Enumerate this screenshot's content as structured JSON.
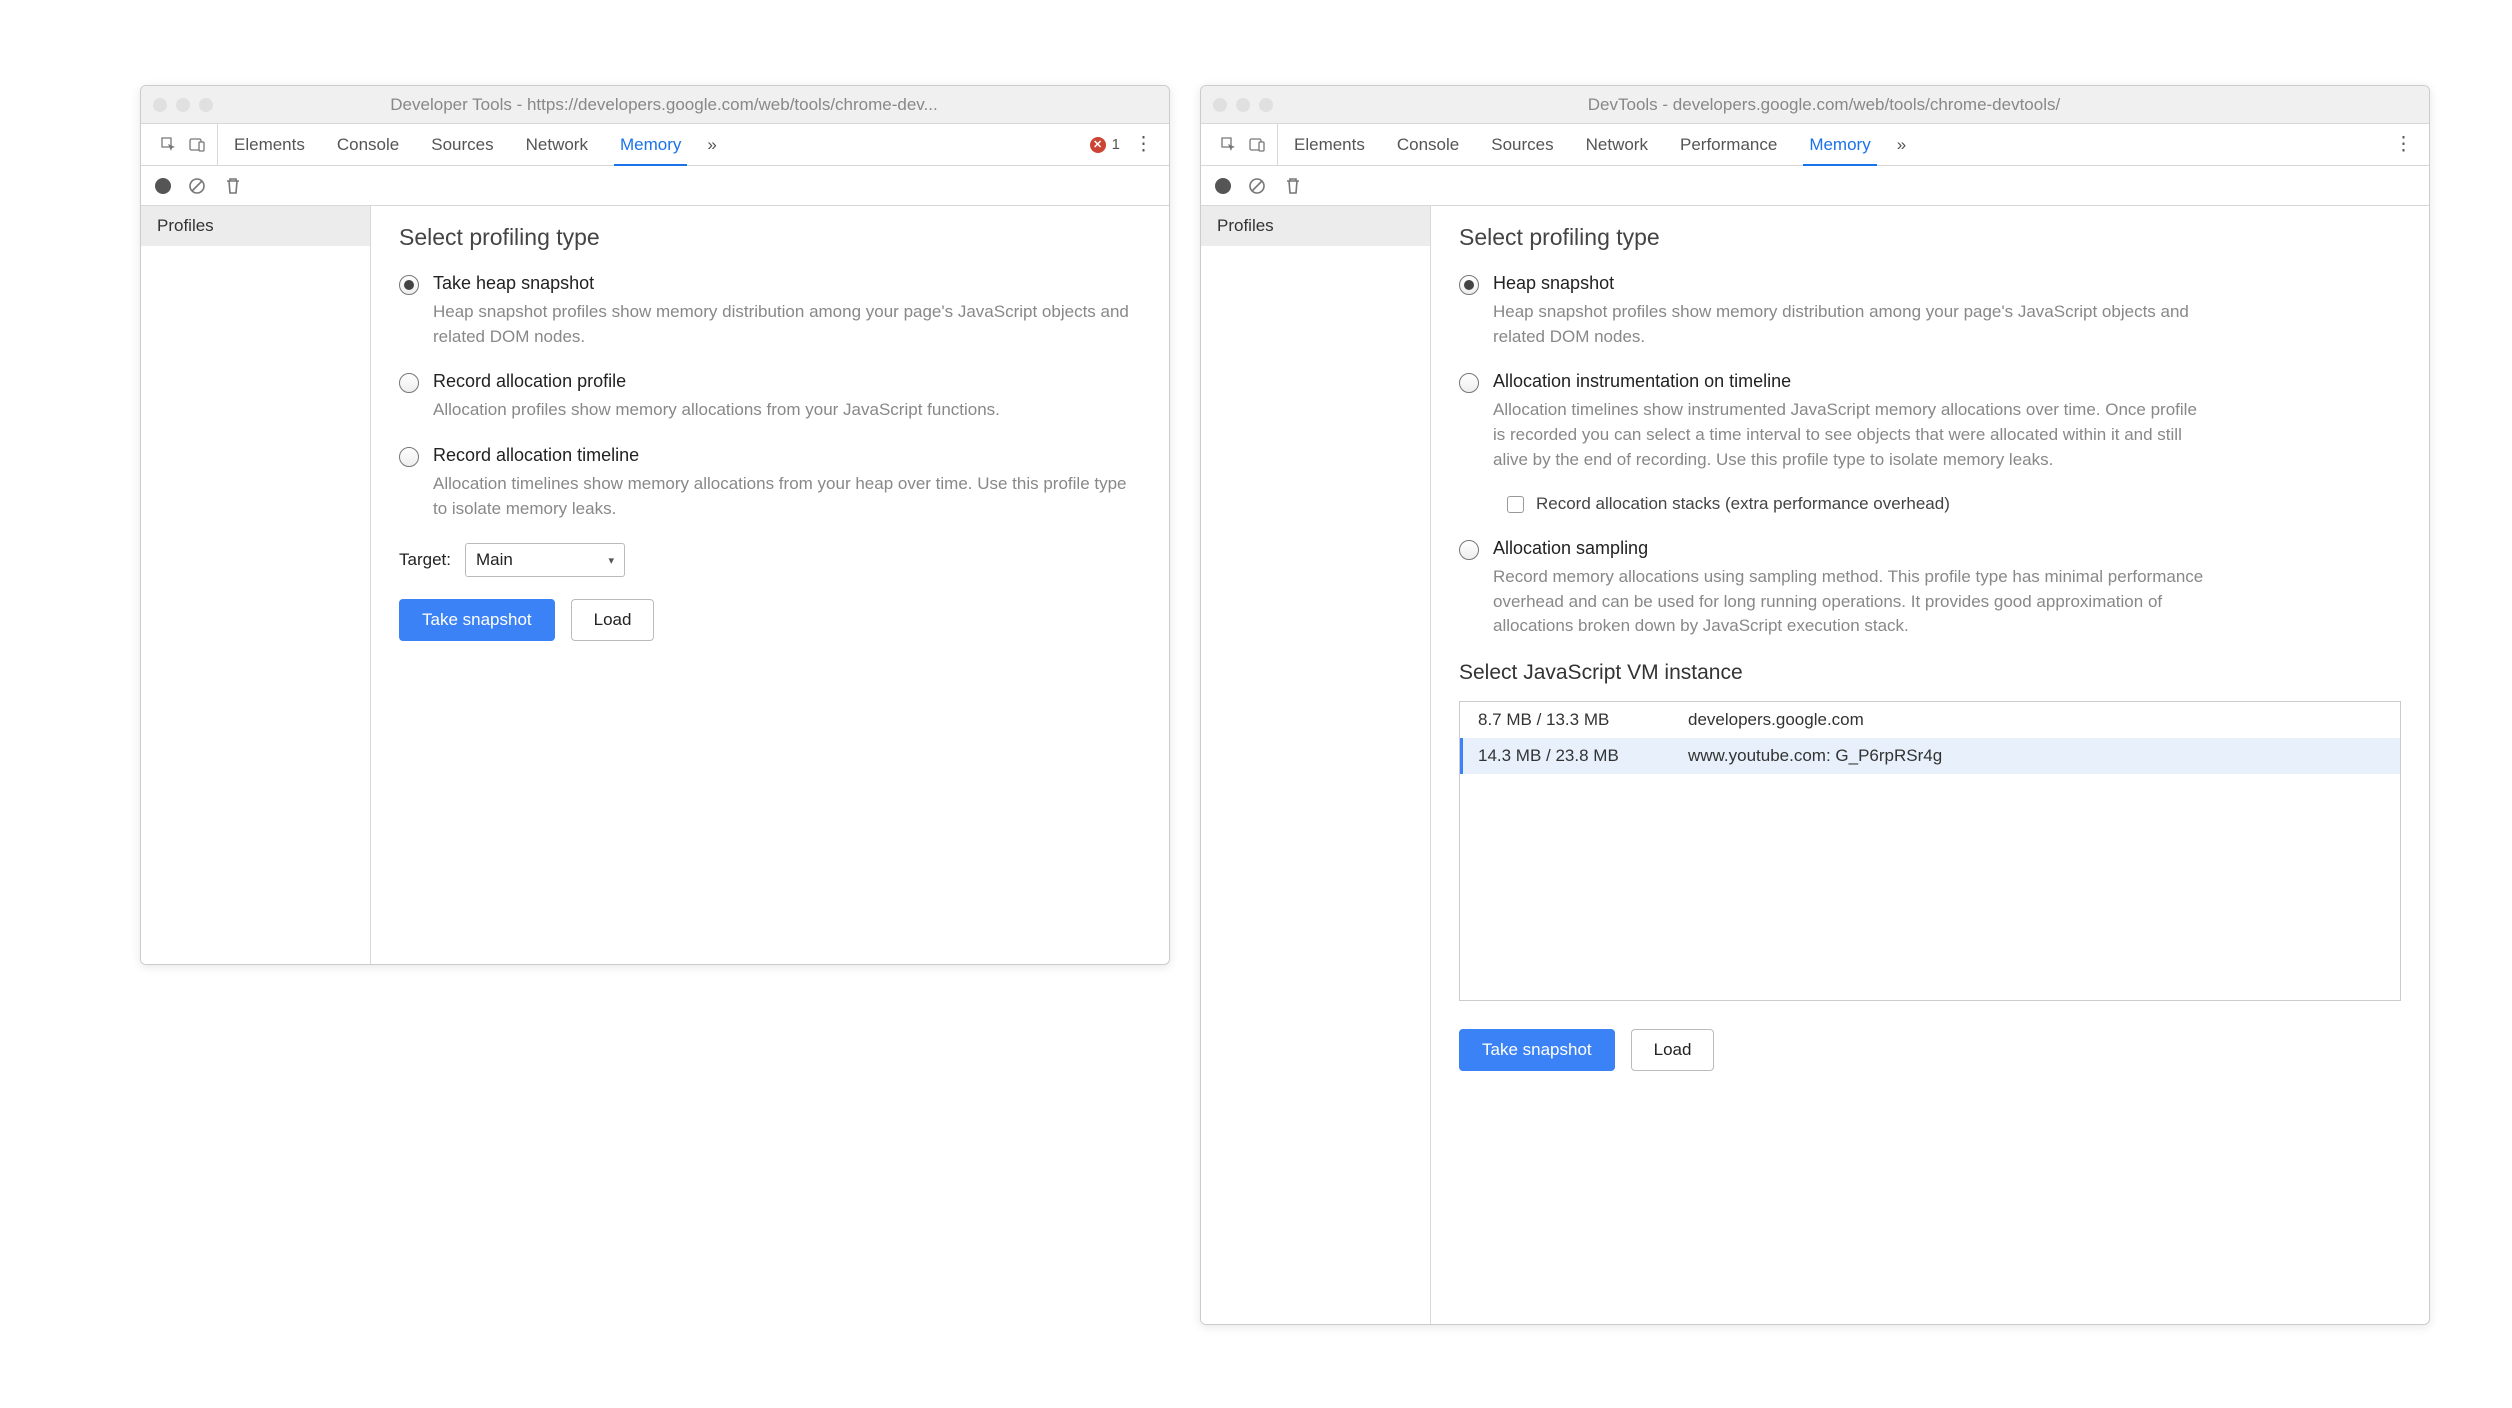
{
  "left": {
    "title": "Developer Tools - https://developers.google.com/web/tools/chrome-dev...",
    "tabs": {
      "elements": "Elements",
      "console": "Console",
      "sources": "Sources",
      "network": "Network",
      "memory": "Memory"
    },
    "error_count": "1",
    "sidebar": {
      "profiles": "Profiles"
    },
    "panel": {
      "heading": "Select profiling type",
      "options": [
        {
          "title": "Take heap snapshot",
          "desc": "Heap snapshot profiles show memory distribution among your page's JavaScript objects and related DOM nodes.",
          "selected": true
        },
        {
          "title": "Record allocation profile",
          "desc": "Allocation profiles show memory allocations from your JavaScript functions.",
          "selected": false
        },
        {
          "title": "Record allocation timeline",
          "desc": "Allocation timelines show memory allocations from your heap over time. Use this profile type to isolate memory leaks.",
          "selected": false
        }
      ],
      "target_label": "Target:",
      "target_value": "Main",
      "take_btn": "Take snapshot",
      "load_btn": "Load"
    }
  },
  "right": {
    "title": "DevTools - developers.google.com/web/tools/chrome-devtools/",
    "tabs": {
      "elements": "Elements",
      "console": "Console",
      "sources": "Sources",
      "network": "Network",
      "performance": "Performance",
      "memory": "Memory"
    },
    "sidebar": {
      "profiles": "Profiles"
    },
    "panel": {
      "heading": "Select profiling type",
      "options": [
        {
          "title": "Heap snapshot",
          "desc": "Heap snapshot profiles show memory distribution among your page's JavaScript objects and related DOM nodes.",
          "selected": true
        },
        {
          "title": "Allocation instrumentation on timeline",
          "desc": "Allocation timelines show instrumented JavaScript memory allocations over time. Once profile is recorded you can select a time interval to see objects that were allocated within it and still alive by the end of recording. Use this profile type to isolate memory leaks.",
          "selected": false
        },
        {
          "title": "Allocation sampling",
          "desc": "Record memory allocations using sampling method. This profile type has minimal performance overhead and can be used for long running operations. It provides good approximation of allocations broken down by JavaScript execution stack.",
          "selected": false
        }
      ],
      "sub_checkbox_label": "Record allocation stacks (extra performance overhead)",
      "vm_heading": "Select JavaScript VM instance",
      "vm_rows": [
        {
          "mem": "8.7 MB / 13.3 MB",
          "host": "developers.google.com",
          "selected": false
        },
        {
          "mem": "14.3 MB / 23.8 MB",
          "host": "www.youtube.com: G_P6rpRSr4g",
          "selected": true
        }
      ],
      "take_btn": "Take snapshot",
      "load_btn": "Load"
    }
  }
}
